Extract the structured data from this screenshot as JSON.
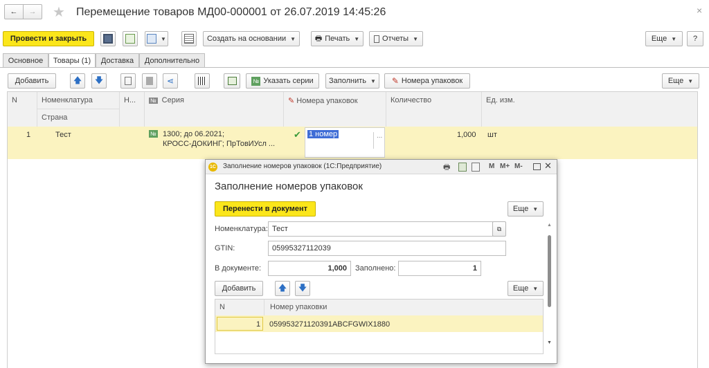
{
  "window": {
    "title": "Перемещение товаров МД00-000001 от 26.07.2019 14:45:26",
    "close_glyph": "×"
  },
  "toolbar": {
    "post_close": "Провести и закрыть",
    "create_based": "Создать на основании",
    "print": "Печать",
    "reports": "Отчеты",
    "more": "Еще",
    "help": "?"
  },
  "tabs": [
    "Основное",
    "Товары (1)",
    "Доставка",
    "Дополнительно"
  ],
  "goods_toolbar": {
    "add": "Добавить",
    "specify_series": "Указать серии",
    "fill": "Заполнить",
    "package_numbers": "Номера упаковок",
    "more": "Еще"
  },
  "grid": {
    "headers": {
      "n": "N",
      "nomenclature": "Номенклатура",
      "country": "Страна",
      "h": "Н...",
      "series": "Серия",
      "package_numbers": "Номера упаковок",
      "quantity": "Количество",
      "unit": "Ед. изм."
    },
    "series_badge": "№",
    "row": {
      "n": "1",
      "nomenclature": "Тест",
      "series_line1": "1300; до 06.2021;",
      "series_line2": "КРОСС-ДОКИНГ; ПрТовИУсл ...",
      "package_number": "1 номер",
      "ellipsis": "...",
      "quantity": "1,000",
      "unit": "шт"
    }
  },
  "dialog": {
    "app_badge": "1С",
    "window_title": "Заполнение номеров упаковок  (1С:Предприятие)",
    "title_tools": [
      "M",
      "M+",
      "M-"
    ],
    "heading": "Заполнение номеров упаковок",
    "transfer_btn": "Перенести в документ",
    "more": "Еще",
    "nomenclature_label": "Номенклатура:",
    "nomenclature_value": "Тест",
    "gtin_label": "GTIN:",
    "gtin_value": "05995327112039",
    "in_doc_label": "В документе:",
    "in_doc_value": "1,000",
    "filled_label": "Заполнено:",
    "filled_value": "1",
    "add": "Добавить",
    "more2": "Еще",
    "table": {
      "col_n": "N",
      "col_package": "Номер упаковки",
      "rows": [
        {
          "n": "1",
          "package": "059953271120391ABCFGWIX1880"
        }
      ]
    }
  },
  "colors": {
    "accent_yellow": "#fbe61b",
    "row_highlight": "#fbf3c0",
    "selection": "#3f6dd6",
    "check_green": "#3a9a3a"
  }
}
